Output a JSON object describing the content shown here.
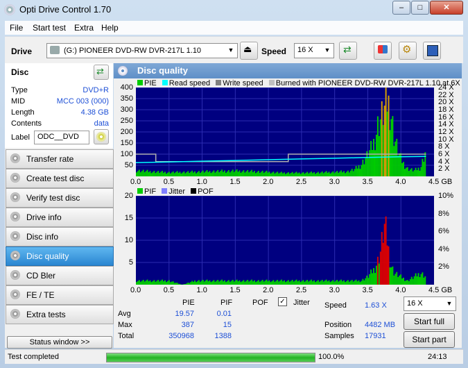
{
  "window": {
    "title": "Opti Drive Control 1.70"
  },
  "menu": [
    "File",
    "Start test",
    "Extra",
    "Help"
  ],
  "toolbar": {
    "drive_label": "Drive",
    "drive_value": "(G:)  PIONEER DVD-RW  DVR-217L 1.10",
    "speed_label": "Speed",
    "speed_value": "16 X"
  },
  "disc": {
    "header": "Disc",
    "rows": [
      {
        "label": "Type",
        "value": "DVD+R"
      },
      {
        "label": "MID",
        "value": "MCC 003 (000)"
      },
      {
        "label": "Length",
        "value": "4.38 GB"
      },
      {
        "label": "Contents",
        "value": "data"
      }
    ],
    "label_label": "Label",
    "label_value": "ODC__DVD"
  },
  "nav": [
    "Transfer rate",
    "Create test disc",
    "Verify test disc",
    "Drive info",
    "Disc info",
    "Disc quality",
    "CD Bler",
    "FE / TE",
    "Extra tests"
  ],
  "nav_active": "Disc quality",
  "status_window_button": "Status window >>",
  "panel_title": "Disc quality",
  "chart_data": [
    {
      "type": "bar",
      "legend": [
        "PIE",
        "Read speed",
        "Write speed",
        "Burned with PIONEER DVD-RW  DVR-217L 1.10 at 6X"
      ],
      "legend_colors": [
        "#00cc00",
        "#00ffff",
        "#808080",
        "#c0c0c0"
      ],
      "xlim": [
        0,
        4.5
      ],
      "ylim": [
        0,
        400
      ],
      "y2lim": [
        0,
        24
      ],
      "x_ticks": [
        "0.0",
        "0.5",
        "1.0",
        "1.5",
        "2.0",
        "2.5",
        "3.0",
        "3.5",
        "4.0",
        "4.5 GB"
      ],
      "y_ticks": [
        "400",
        "350",
        "300",
        "250",
        "200",
        "150",
        "100",
        "50"
      ],
      "y2_ticks": [
        "24 X",
        "22 X",
        "20 X",
        "18 X",
        "16 X",
        "14 X",
        "12 X",
        "10 X",
        "8 X",
        "6 X",
        "4 X",
        "2 X"
      ],
      "series": [
        {
          "name": "PIE",
          "x": [
            0.0,
            0.2,
            0.5,
            0.8,
            1.0,
            1.2,
            1.5,
            1.8,
            2.0,
            2.2,
            2.5,
            2.8,
            3.0,
            3.2,
            3.3,
            3.4,
            3.5,
            3.55,
            3.6,
            3.65,
            3.7,
            3.75,
            3.8,
            3.85,
            3.9,
            3.95,
            4.0,
            4.05,
            4.1,
            4.2,
            4.3,
            4.38
          ],
          "y": [
            30,
            25,
            20,
            22,
            24,
            26,
            28,
            25,
            22,
            18,
            18,
            20,
            22,
            25,
            35,
            60,
            110,
            140,
            180,
            260,
            300,
            340,
            387,
            330,
            200,
            140,
            90,
            60,
            40,
            30,
            45,
            140
          ]
        },
        {
          "name": "Read speed",
          "x": [
            0.0,
            0.5,
            1.0,
            1.5,
            2.0,
            2.5,
            3.0,
            3.5,
            4.0,
            4.38
          ],
          "y": [
            3.7,
            3.9,
            4.1,
            4.3,
            4.5,
            4.7,
            4.9,
            5.1,
            5.3,
            5.4
          ]
        },
        {
          "name": "Write speed",
          "x": [
            0.0,
            0.3,
            0.3,
            1.0,
            2.0,
            2.3,
            2.3,
            3.0,
            4.0,
            4.38
          ],
          "y": [
            6.0,
            6.0,
            4.0,
            4.0,
            4.0,
            4.0,
            6.0,
            6.0,
            6.0,
            6.0
          ]
        }
      ]
    },
    {
      "type": "bar",
      "legend": [
        "PIF",
        "Jitter",
        "POF"
      ],
      "legend_colors": [
        "#00cc00",
        "#8080ff",
        "#000000"
      ],
      "xlim": [
        0,
        4.5
      ],
      "ylim": [
        0,
        20
      ],
      "y2lim": [
        0,
        10
      ],
      "x_ticks": [
        "0.0",
        "0.5",
        "1.0",
        "1.5",
        "2.0",
        "2.5",
        "3.0",
        "3.5",
        "4.0",
        "4.5 GB"
      ],
      "y_ticks": [
        "20",
        "15",
        "10",
        "5"
      ],
      "y2_ticks": [
        "10%",
        "8%",
        "6%",
        "4%",
        "2%"
      ],
      "series": [
        {
          "name": "PIF",
          "x": [
            0.1,
            0.3,
            0.5,
            0.7,
            0.9,
            1.1,
            1.3,
            1.6,
            1.9,
            2.1,
            2.4,
            2.7,
            3.0,
            3.2,
            3.4,
            3.5,
            3.6,
            3.65,
            3.7,
            3.72,
            3.75,
            3.78,
            3.8,
            3.82,
            3.85,
            3.9,
            4.0,
            4.1,
            4.3,
            4.38
          ],
          "y": [
            1,
            1,
            1,
            0,
            1,
            1,
            1,
            1,
            1,
            1,
            1,
            1,
            1,
            1,
            1,
            2,
            4,
            6,
            9,
            12,
            15,
            13,
            11,
            8,
            5,
            3,
            2,
            1,
            3,
            2
          ]
        }
      ]
    }
  ],
  "stats": {
    "headers": [
      "PIE",
      "PIF",
      "POF"
    ],
    "jitter_label": "Jitter",
    "rows": [
      {
        "label": "Avg",
        "pie": "19.57",
        "pif": "0.01"
      },
      {
        "label": "Max",
        "pie": "387",
        "pif": "15"
      },
      {
        "label": "Total",
        "pie": "350968",
        "pif": "1388"
      }
    ],
    "speed_label": "Speed",
    "speed_value": "1.63 X",
    "position_label": "Position",
    "position_value": "4482 MB",
    "samples_label": "Samples",
    "samples_value": "17931",
    "speed_select": "16 X",
    "start_full": "Start full",
    "start_part": "Start part"
  },
  "status": {
    "text": "Test completed",
    "progress": 100,
    "progress_text": "100.0%",
    "time": "24:13"
  }
}
